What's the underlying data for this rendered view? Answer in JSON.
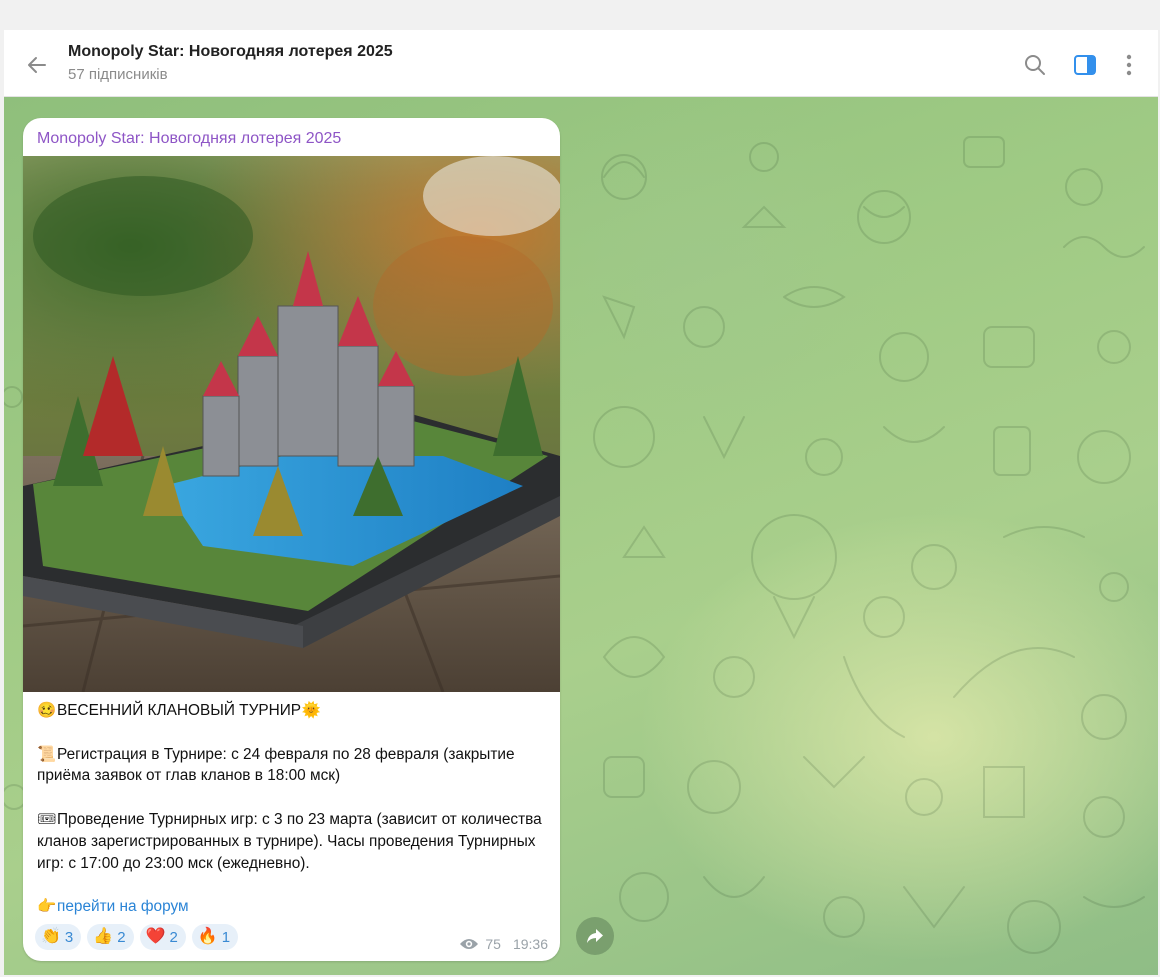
{
  "header": {
    "title": "Monopoly Star: Новогодняя лотерея 2025",
    "subtitle": "57 підписників",
    "icons": [
      "back-arrow-icon",
      "search-icon",
      "sidebar-toggle-icon",
      "more-vertical-icon"
    ],
    "accent_color": "#3390ec"
  },
  "message": {
    "sender": "Monopoly Star: Новогодняя лотерея 2025",
    "sender_color": "#8e55c6",
    "photo_description_icon": "castle-diorama-photo",
    "line1_emoji": "🥴",
    "line1_text": "ВЕСЕННИЙ КЛАНОВЫЙ ТУРНИР",
    "line1_emoji_end": "🌞",
    "line2_emoji": "📜",
    "line2_text": "Регистрация в Турнире: с 24 февраля по 28 февраля (закрытие приёма заявок от глав кланов в 18:00 мск)",
    "line3_emoji": "🎟",
    "line3_text": "Проведение Турнирных игр: с 3 по 23 марта (зависит от количества кланов зарегистрированных в турнире). Часы проведения Турнирных игр: с 17:00 до 23:00 мск (ежедневно).",
    "link_emoji": "👉",
    "link_text": "перейти на форум",
    "link_color": "#2a84d6",
    "reactions": [
      {
        "emoji": "👏",
        "count": "3"
      },
      {
        "emoji": "👍",
        "count": "2"
      },
      {
        "emoji": "❤️",
        "count": "2"
      },
      {
        "emoji": "🔥",
        "count": "1"
      }
    ],
    "views": "75",
    "time": "19:36"
  }
}
